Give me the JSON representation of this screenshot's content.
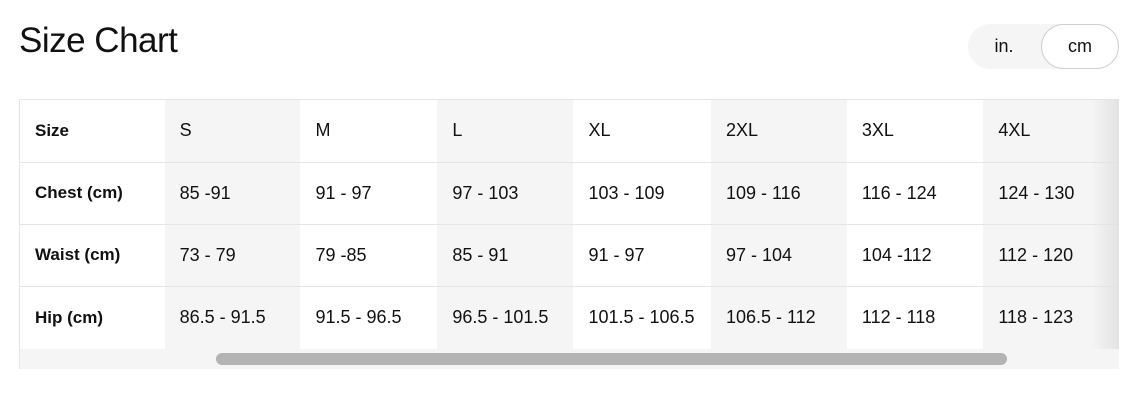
{
  "header": {
    "title": "Size Chart"
  },
  "unit_toggle": {
    "options": [
      "in.",
      "cm"
    ],
    "selected": "cm"
  },
  "size_table": {
    "rows": [
      {
        "label": "Size",
        "values": [
          "S",
          "M",
          "L",
          "XL",
          "2XL",
          "3XL",
          "4XL"
        ]
      },
      {
        "label": "Chest (cm)",
        "values": [
          "85 -91",
          "91 - 97",
          "97 - 103",
          "103 - 109",
          "109 - 116",
          "116 - 124",
          "124 - 130"
        ]
      },
      {
        "label": "Waist (cm)",
        "values": [
          "73 - 79",
          "79 -85",
          "85 - 91",
          "91 - 97",
          "97 - 104",
          "104 -112",
          "112 - 120"
        ]
      },
      {
        "label": "Hip (cm)",
        "values": [
          "86.5 - 91.5",
          "91.5 - 96.5",
          "96.5 - 101.5",
          "101.5 - 106.5",
          "106.5 - 112",
          "112 - 118",
          "118 - 123"
        ]
      }
    ]
  }
}
